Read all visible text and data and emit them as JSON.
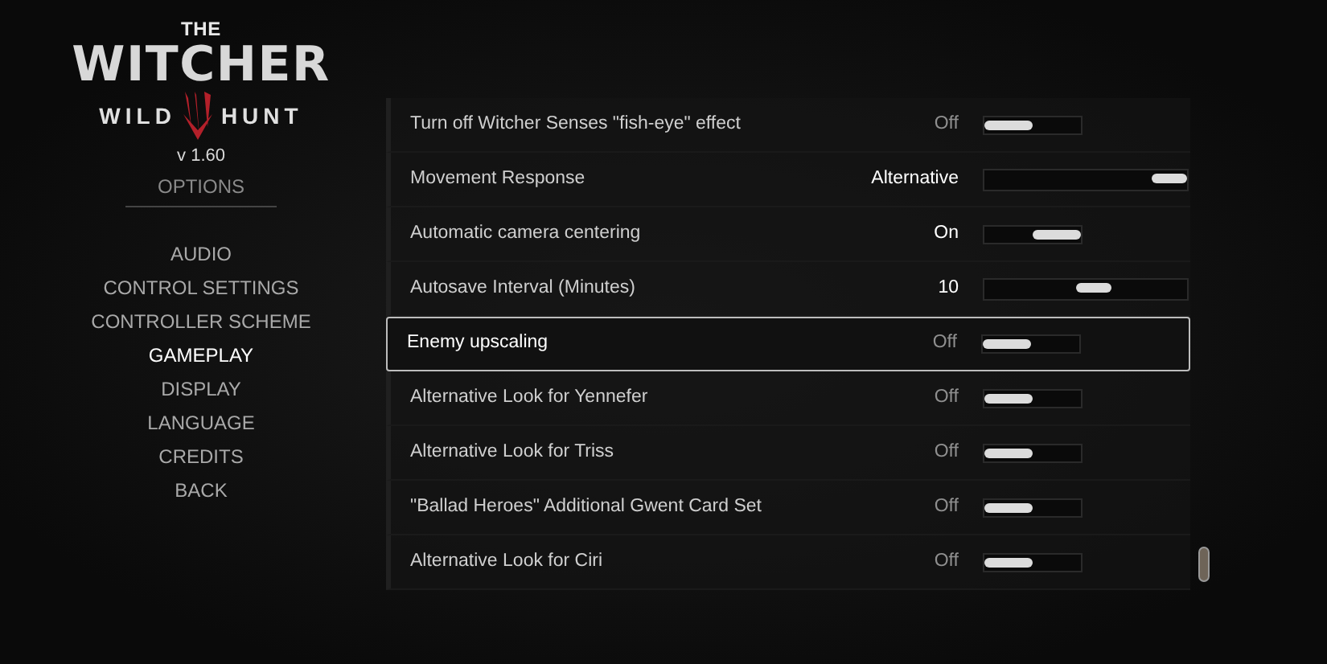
{
  "logo": {
    "top": "THE",
    "title": "WITCHER",
    "left": "WILD",
    "right": "HUNT"
  },
  "version": "v 1.60",
  "menu": {
    "heading": "OPTIONS",
    "items": [
      {
        "label": "AUDIO",
        "selected": false
      },
      {
        "label": "CONTROL SETTINGS",
        "selected": false
      },
      {
        "label": "CONTROLLER SCHEME",
        "selected": false
      },
      {
        "label": "GAMEPLAY",
        "selected": true
      },
      {
        "label": "DISPLAY",
        "selected": false
      },
      {
        "label": "LANGUAGE",
        "selected": false
      },
      {
        "label": "CREDITS",
        "selected": false
      },
      {
        "label": "BACK",
        "selected": false
      }
    ]
  },
  "settings": [
    {
      "label": "Turn off Witcher Senses \"fish-eye\" effect",
      "value": "Off",
      "kind": "toggle",
      "level": 0,
      "selected": false
    },
    {
      "label": "Movement Response",
      "value": "Alternative",
      "kind": "slider",
      "level": 1,
      "selected": false
    },
    {
      "label": "Automatic camera centering",
      "value": "On",
      "kind": "toggle",
      "level": 1,
      "selected": false
    },
    {
      "label": "Autosave Interval (Minutes)",
      "value": "10",
      "kind": "slider",
      "level": 0.55,
      "selected": false
    },
    {
      "label": "Enemy upscaling",
      "value": "Off",
      "kind": "toggle",
      "level": 0,
      "selected": true
    },
    {
      "label": "Alternative Look for Yennefer",
      "value": "Off",
      "kind": "toggle",
      "level": 0,
      "selected": false
    },
    {
      "label": "Alternative Look for Triss",
      "value": "Off",
      "kind": "toggle",
      "level": 0,
      "selected": false
    },
    {
      "label": "\"Ballad Heroes\" Additional Gwent Card Set",
      "value": "Off",
      "kind": "toggle",
      "level": 0,
      "selected": false
    },
    {
      "label": "Alternative Look for Ciri",
      "value": "Off",
      "kind": "toggle",
      "level": 0,
      "selected": false
    }
  ]
}
